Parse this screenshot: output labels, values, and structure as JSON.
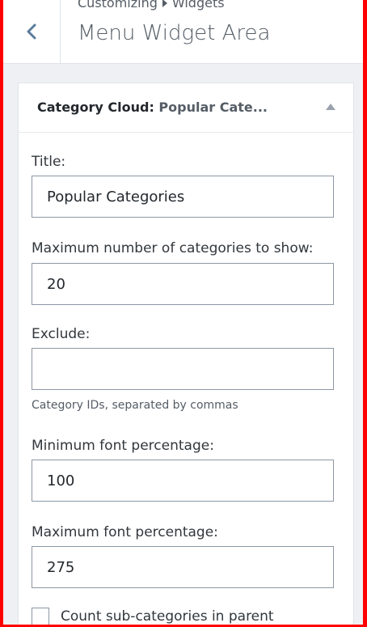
{
  "header": {
    "breadcrumb_parent": "Customizing",
    "breadcrumb_child": "Widgets",
    "title": "Menu Widget Area"
  },
  "widget": {
    "name": "Category Cloud:",
    "instance_title": "Popular Cate...",
    "fields": {
      "title_label": "Title:",
      "title_value": "Popular Categories",
      "max_categories_label": "Maximum number of categories to show:",
      "max_categories_value": "20",
      "exclude_label": "Exclude:",
      "exclude_value": "",
      "exclude_hint": "Category IDs, separated by commas",
      "min_font_label": "Minimum font percentage:",
      "min_font_value": "100",
      "max_font_label": "Maximum font percentage:",
      "max_font_value": "275",
      "count_sub_label": "Count sub-categories in parent"
    }
  },
  "colors": {
    "frame_border": "#ff0000",
    "background": "#eef0f3",
    "accent": "#0073aa"
  }
}
